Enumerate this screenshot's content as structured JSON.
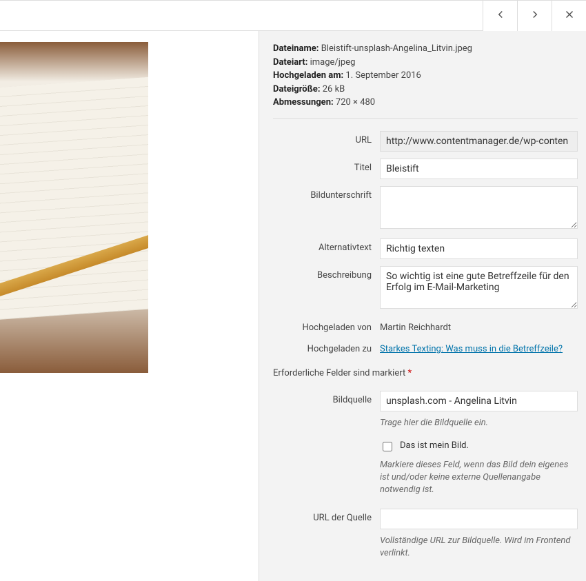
{
  "meta": {
    "filename_label": "Dateiname:",
    "filename_value": "Bleistift-unsplash-Angelina_Litvin.jpeg",
    "filetype_label": "Dateiart:",
    "filetype_value": "image/jpeg",
    "uploaded_on_label": "Hochgeladen am:",
    "uploaded_on_value": "1. September 2016",
    "filesize_label": "Dateigröße:",
    "filesize_value": "26 kB",
    "dimensions_label": "Abmessungen:",
    "dimensions_value": "720 × 480"
  },
  "fields": {
    "url_label": "URL",
    "url_value": "http://www.contentmanager.de/wp-conten",
    "title_label": "Titel",
    "title_value": "Bleistift",
    "caption_label": "Bildunterschrift",
    "caption_value": "",
    "alt_label": "Alternativtext",
    "alt_value": "Richtig texten",
    "desc_label": "Beschreibung",
    "desc_value": "So wichtig ist eine gute Betreffzeile für den Erfolg im E-Mail-Marketing",
    "uploaded_by_label": "Hochgeladen von",
    "uploaded_by_value": "Martin Reichhardt",
    "uploaded_to_label": "Hochgeladen zu",
    "uploaded_to_value": "Starkes Texting: Was muss in die Betreffzeile?"
  },
  "required_note": "Erforderliche Felder sind markiert",
  "required_asterisk": "*",
  "source": {
    "bildquelle_label": "Bildquelle",
    "bildquelle_value": "unsplash.com - Angelina Litvin",
    "bildquelle_hint": "Trage hier die Bildquelle ein.",
    "my_image_label": "Das ist mein Bild.",
    "my_image_hint": "Markiere dieses Feld, wenn das Bild dein eigenes ist und/oder keine externe Quellenangabe notwendig ist.",
    "url_source_label": "URL der Quelle",
    "url_source_value": "",
    "url_source_hint": "Vollständige URL zur Bildquelle. Wird im Frontend verlinkt."
  }
}
